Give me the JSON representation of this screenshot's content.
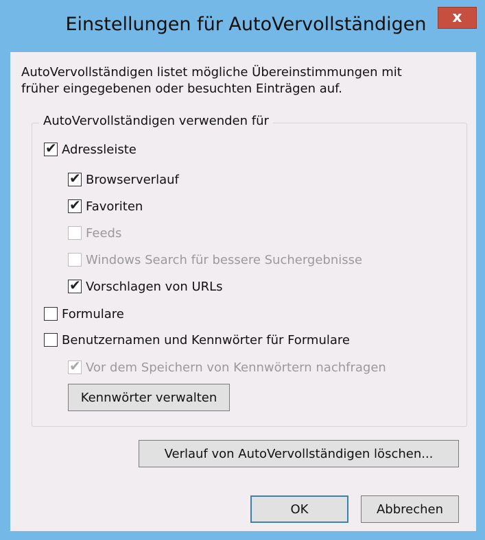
{
  "window": {
    "title": "Einstellungen für AutoVervollständigen",
    "close_label": "x"
  },
  "description": {
    "line1": "AutoVervollständigen listet mögliche Übereinstimmungen mit",
    "line2": "früher eingegebenen oder besuchten Einträgen auf."
  },
  "group": {
    "legend": "AutoVervollständigen verwenden für",
    "items": [
      {
        "label": "Adressleiste",
        "checked": true,
        "enabled": true
      },
      {
        "label": "Browserverlauf",
        "checked": true,
        "enabled": true
      },
      {
        "label": "Favoriten",
        "checked": true,
        "enabled": true
      },
      {
        "label": "Feeds",
        "checked": false,
        "enabled": false
      },
      {
        "label": "Windows Search für bessere Suchergebnisse",
        "checked": false,
        "enabled": false
      },
      {
        "label": "Vorschlagen von URLs",
        "checked": true,
        "enabled": true
      },
      {
        "label": "Formulare",
        "checked": false,
        "enabled": true
      },
      {
        "label": "Benutzernamen und Kennwörter für Formulare",
        "checked": false,
        "enabled": true
      },
      {
        "label": "Vor dem Speichern von Kennwörtern nachfragen",
        "checked": true,
        "enabled": false
      }
    ],
    "manage_passwords_button": "Kennwörter verwalten"
  },
  "buttons": {
    "clear_history": "Verlauf von AutoVervollständigen löschen...",
    "ok": "OK",
    "cancel": "Abbrechen"
  },
  "check_glyph": "✔"
}
